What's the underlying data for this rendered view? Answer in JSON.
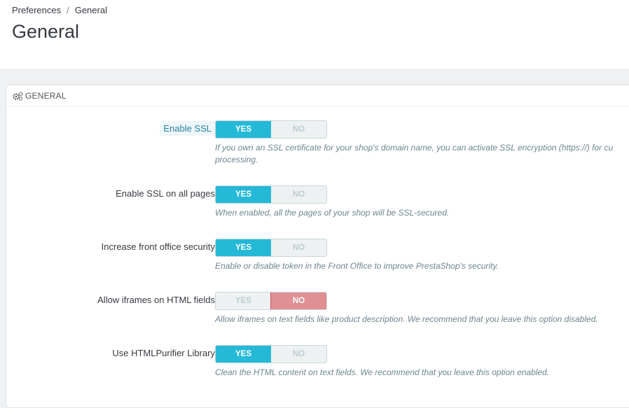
{
  "breadcrumb": {
    "parent": "Preferences",
    "separator": "/",
    "current": "General"
  },
  "page_title": "General",
  "panel": {
    "heading": "General",
    "icon": "gears-icon"
  },
  "colors": {
    "yes_active": "#25b9d7",
    "no_active": "#e08f95",
    "link_label": "#25829e"
  },
  "settings": [
    {
      "label": "Enable SSL",
      "yes": "YES",
      "no": "NO",
      "value": "yes",
      "highlighted": true,
      "help_line1": "If you own an SSL certificate for your shop's domain name, you can activate SSL encryption (https://) for cu",
      "help_line2": "processing."
    },
    {
      "label": "Enable SSL on all pages",
      "yes": "YES",
      "no": "NO",
      "value": "yes",
      "help": "When enabled, all the pages of your shop will be SSL-secured."
    },
    {
      "label": "Increase front office security",
      "yes": "YES",
      "no": "NO",
      "value": "yes",
      "help": "Enable or disable token in the Front Office to improve PrestaShop's security."
    },
    {
      "label": "Allow iframes on HTML fields",
      "yes": "YES",
      "no": "NO",
      "value": "no",
      "help": "Allow iframes on text fields like product description. We recommend that you leave this option disabled."
    },
    {
      "label": "Use HTMLPurifier Library",
      "yes": "YES",
      "no": "NO",
      "value": "yes",
      "help": "Clean the HTML content on text fields. We recommend that you leave this option enabled."
    }
  ]
}
